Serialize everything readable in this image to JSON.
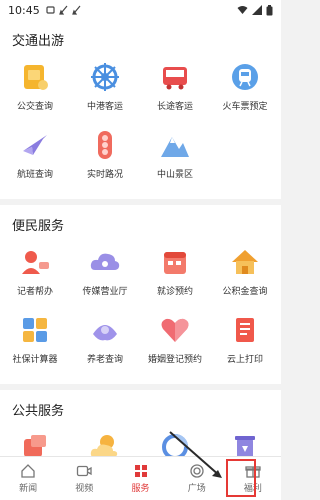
{
  "status": {
    "time": "10:45"
  },
  "sections": [
    {
      "title": "交通出游",
      "items": [
        {
          "label": "公交查询",
          "icon": "bus-card-icon"
        },
        {
          "label": "中港客运",
          "icon": "ship-wheel-icon"
        },
        {
          "label": "长途客运",
          "icon": "coach-bus-icon"
        },
        {
          "label": "火车票预定",
          "icon": "train-icon"
        },
        {
          "label": "航班查询",
          "icon": "airplane-icon"
        },
        {
          "label": "实时路况",
          "icon": "traffic-light-icon"
        },
        {
          "label": "中山景区",
          "icon": "mountain-icon"
        }
      ]
    },
    {
      "title": "便民服务",
      "items": [
        {
          "label": "记者帮办",
          "icon": "reporter-icon"
        },
        {
          "label": "传媒营业厅",
          "icon": "cloud-hall-icon"
        },
        {
          "label": "就诊预约",
          "icon": "calendar-icon"
        },
        {
          "label": "公积金查询",
          "icon": "house-icon"
        },
        {
          "label": "社保计算器",
          "icon": "calculator-icon"
        },
        {
          "label": "养老查询",
          "icon": "elder-icon"
        },
        {
          "label": "婚姻登记预约",
          "icon": "heart-icon"
        },
        {
          "label": "云上打印",
          "icon": "document-icon"
        }
      ]
    },
    {
      "title": "公共服务",
      "items": [
        {
          "label": "",
          "icon": "public-service-1-icon"
        },
        {
          "label": "",
          "icon": "weather-icon"
        },
        {
          "label": "",
          "icon": "public-service-3-icon"
        },
        {
          "label": "",
          "icon": "recycle-bin-icon"
        }
      ]
    }
  ],
  "tabs": [
    {
      "label": "新闻",
      "icon": "home-icon"
    },
    {
      "label": "视频",
      "icon": "video-icon"
    },
    {
      "label": "服务",
      "icon": "grid-icon"
    },
    {
      "label": "广场",
      "icon": "square-icon"
    },
    {
      "label": "福利",
      "icon": "gift-icon"
    }
  ],
  "colors": {
    "accent": "#e03a3a",
    "highlight": "#e53935"
  }
}
